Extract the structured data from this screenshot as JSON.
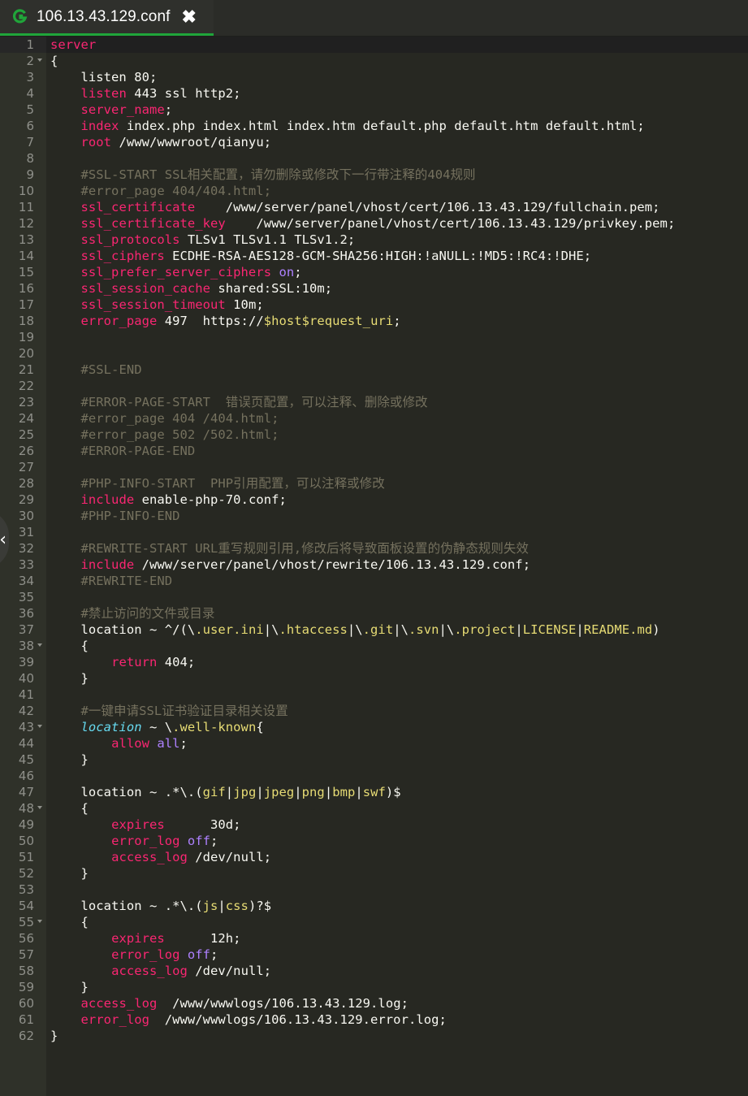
{
  "tab": {
    "title": "106.13.43.129.conf",
    "close_glyph": "✖",
    "icon": "g-logo-icon",
    "accent": "#20a53a"
  },
  "side_toggle": {
    "glyph": "‹",
    "icon": "chevron-left-icon"
  },
  "editor": {
    "active_line": 1,
    "fold_lines": [
      2,
      38,
      43,
      48,
      55
    ],
    "colors": {
      "background": "#272822",
      "gutter": "#2f3129",
      "keyword": "#f92672",
      "comment": "#75715e",
      "string_var": "#e6db74",
      "constant": "#ae81ff",
      "function": "#66d9ef",
      "plain": "#f8f8f2"
    },
    "lines": [
      [
        [
          "kw",
          "server"
        ]
      ],
      [
        [
          "p",
          "{"
        ]
      ],
      [
        [
          "p",
          "    listen 80;"
        ]
      ],
      [
        [
          "p",
          "    "
        ],
        [
          "kw",
          "listen"
        ],
        [
          "p",
          " 443 ssl http2;"
        ]
      ],
      [
        [
          "p",
          "    "
        ],
        [
          "kw",
          "server_name"
        ],
        [
          "p",
          ";"
        ]
      ],
      [
        [
          "p",
          "    "
        ],
        [
          "kw",
          "index"
        ],
        [
          "p",
          " index.php index.html index.htm default.php default.htm default.html;"
        ]
      ],
      [
        [
          "p",
          "    "
        ],
        [
          "kw",
          "root"
        ],
        [
          "p",
          " /www/wwwroot/qianyu;"
        ]
      ],
      [
        [
          "p",
          ""
        ]
      ],
      [
        [
          "p",
          "    "
        ],
        [
          "c",
          "#SSL-START SSL相关配置，请勿删除或修改下一行带注释的404规则"
        ]
      ],
      [
        [
          "p",
          "    "
        ],
        [
          "c",
          "#error_page 404/404.html;"
        ]
      ],
      [
        [
          "p",
          "    "
        ],
        [
          "kw",
          "ssl_certificate"
        ],
        [
          "p",
          "    /www/server/panel/vhost/cert/106.13.43.129/fullchain.pem;"
        ]
      ],
      [
        [
          "p",
          "    "
        ],
        [
          "kw",
          "ssl_certificate_key"
        ],
        [
          "p",
          "    /www/server/panel/vhost/cert/106.13.43.129/privkey.pem;"
        ]
      ],
      [
        [
          "p",
          "    "
        ],
        [
          "kw",
          "ssl_protocols"
        ],
        [
          "p",
          " TLSv1 TLSv1.1 TLSv1.2;"
        ]
      ],
      [
        [
          "p",
          "    "
        ],
        [
          "kw",
          "ssl_ciphers"
        ],
        [
          "p",
          " ECDHE-RSA-AES128-GCM-SHA256:HIGH:!aNULL:!MD5:!RC4:!DHE;"
        ]
      ],
      [
        [
          "p",
          "    "
        ],
        [
          "kw",
          "ssl_prefer_server_ciphers"
        ],
        [
          "p",
          " "
        ],
        [
          "const",
          "on"
        ],
        [
          "p",
          ";"
        ]
      ],
      [
        [
          "p",
          "    "
        ],
        [
          "kw",
          "ssl_session_cache"
        ],
        [
          "p",
          " shared:SSL:10m;"
        ]
      ],
      [
        [
          "p",
          "    "
        ],
        [
          "kw",
          "ssl_session_timeout"
        ],
        [
          "p",
          " 10m;"
        ]
      ],
      [
        [
          "p",
          "    "
        ],
        [
          "kw",
          "error_page"
        ],
        [
          "p",
          " 497  https://"
        ],
        [
          "var",
          "$host$request_uri"
        ],
        [
          "p",
          ";"
        ]
      ],
      [
        [
          "p",
          ""
        ]
      ],
      [
        [
          "p",
          ""
        ]
      ],
      [
        [
          "p",
          "    "
        ],
        [
          "c",
          "#SSL-END"
        ]
      ],
      [
        [
          "p",
          ""
        ]
      ],
      [
        [
          "p",
          "    "
        ],
        [
          "c",
          "#ERROR-PAGE-START  错误页配置，可以注释、删除或修改"
        ]
      ],
      [
        [
          "p",
          "    "
        ],
        [
          "c",
          "#error_page 404 /404.html;"
        ]
      ],
      [
        [
          "p",
          "    "
        ],
        [
          "c",
          "#error_page 502 /502.html;"
        ]
      ],
      [
        [
          "p",
          "    "
        ],
        [
          "c",
          "#ERROR-PAGE-END"
        ]
      ],
      [
        [
          "p",
          ""
        ]
      ],
      [
        [
          "p",
          "    "
        ],
        [
          "c",
          "#PHP-INFO-START  PHP引用配置，可以注释或修改"
        ]
      ],
      [
        [
          "p",
          "    "
        ],
        [
          "kw",
          "include"
        ],
        [
          "p",
          " enable-php-70.conf;"
        ]
      ],
      [
        [
          "p",
          "    "
        ],
        [
          "c",
          "#PHP-INFO-END"
        ]
      ],
      [
        [
          "p",
          ""
        ]
      ],
      [
        [
          "p",
          "    "
        ],
        [
          "c",
          "#REWRITE-START URL重写规则引用,修改后将导致面板设置的伪静态规则失效"
        ]
      ],
      [
        [
          "p",
          "    "
        ],
        [
          "kw",
          "include"
        ],
        [
          "p",
          " /www/server/panel/vhost/rewrite/106.13.43.129.conf;"
        ]
      ],
      [
        [
          "p",
          "    "
        ],
        [
          "c",
          "#REWRITE-END"
        ]
      ],
      [
        [
          "p",
          ""
        ]
      ],
      [
        [
          "p",
          "    "
        ],
        [
          "c",
          "#禁止访问的文件或目录"
        ]
      ],
      [
        [
          "p",
          "    location ~ ^/(\\"
        ],
        [
          "var",
          ".user.ini"
        ],
        [
          "p",
          "|\\"
        ],
        [
          "var",
          ".htaccess"
        ],
        [
          "p",
          "|\\"
        ],
        [
          "var",
          ".git"
        ],
        [
          "p",
          "|\\"
        ],
        [
          "var",
          ".svn"
        ],
        [
          "p",
          "|\\"
        ],
        [
          "var",
          ".project"
        ],
        [
          "p",
          "|"
        ],
        [
          "var",
          "LICENSE"
        ],
        [
          "p",
          "|"
        ],
        [
          "var",
          "README.md"
        ],
        [
          "p",
          ")"
        ]
      ],
      [
        [
          "p",
          "    {"
        ]
      ],
      [
        [
          "p",
          "        "
        ],
        [
          "kw",
          "return"
        ],
        [
          "p",
          " 404;"
        ]
      ],
      [
        [
          "p",
          "    }"
        ]
      ],
      [
        [
          "p",
          ""
        ]
      ],
      [
        [
          "p",
          "    "
        ],
        [
          "c",
          "#一键申请SSL证书验证目录相关设置"
        ]
      ],
      [
        [
          "p",
          "    "
        ],
        [
          "fn",
          "location"
        ],
        [
          "p",
          " ~ \\"
        ],
        [
          "var",
          ".well-known"
        ],
        [
          "p",
          "{"
        ]
      ],
      [
        [
          "p",
          "        "
        ],
        [
          "kw",
          "allow"
        ],
        [
          "p",
          " "
        ],
        [
          "const",
          "all"
        ],
        [
          "p",
          ";"
        ]
      ],
      [
        [
          "p",
          "    }"
        ]
      ],
      [
        [
          "p",
          ""
        ]
      ],
      [
        [
          "p",
          "    location ~ .*\\.("
        ],
        [
          "var",
          "gif"
        ],
        [
          "p",
          "|"
        ],
        [
          "var",
          "jpg"
        ],
        [
          "p",
          "|"
        ],
        [
          "var",
          "jpeg"
        ],
        [
          "p",
          "|"
        ],
        [
          "var",
          "png"
        ],
        [
          "p",
          "|"
        ],
        [
          "var",
          "bmp"
        ],
        [
          "p",
          "|"
        ],
        [
          "var",
          "swf"
        ],
        [
          "p",
          ")$"
        ]
      ],
      [
        [
          "p",
          "    {"
        ]
      ],
      [
        [
          "p",
          "        "
        ],
        [
          "kw",
          "expires"
        ],
        [
          "p",
          "      30d;"
        ]
      ],
      [
        [
          "p",
          "        "
        ],
        [
          "kw",
          "error_log"
        ],
        [
          "p",
          " "
        ],
        [
          "const",
          "off"
        ],
        [
          "p",
          ";"
        ]
      ],
      [
        [
          "p",
          "        "
        ],
        [
          "kw",
          "access_log"
        ],
        [
          "p",
          " /dev/null;"
        ]
      ],
      [
        [
          "p",
          "    }"
        ]
      ],
      [
        [
          "p",
          ""
        ]
      ],
      [
        [
          "p",
          "    location ~ .*\\.("
        ],
        [
          "var",
          "js"
        ],
        [
          "p",
          "|"
        ],
        [
          "var",
          "css"
        ],
        [
          "p",
          ")?$"
        ]
      ],
      [
        [
          "p",
          "    {"
        ]
      ],
      [
        [
          "p",
          "        "
        ],
        [
          "kw",
          "expires"
        ],
        [
          "p",
          "      12h;"
        ]
      ],
      [
        [
          "p",
          "        "
        ],
        [
          "kw",
          "error_log"
        ],
        [
          "p",
          " "
        ],
        [
          "const",
          "off"
        ],
        [
          "p",
          ";"
        ]
      ],
      [
        [
          "p",
          "        "
        ],
        [
          "kw",
          "access_log"
        ],
        [
          "p",
          " /dev/null;"
        ]
      ],
      [
        [
          "p",
          "    }"
        ]
      ],
      [
        [
          "p",
          "    "
        ],
        [
          "kw",
          "access_log"
        ],
        [
          "p",
          "  /www/wwwlogs/106.13.43.129.log;"
        ]
      ],
      [
        [
          "p",
          "    "
        ],
        [
          "kw",
          "error_log"
        ],
        [
          "p",
          "  /www/wwwlogs/106.13.43.129.error.log;"
        ]
      ],
      [
        [
          "p",
          "}"
        ]
      ]
    ]
  }
}
